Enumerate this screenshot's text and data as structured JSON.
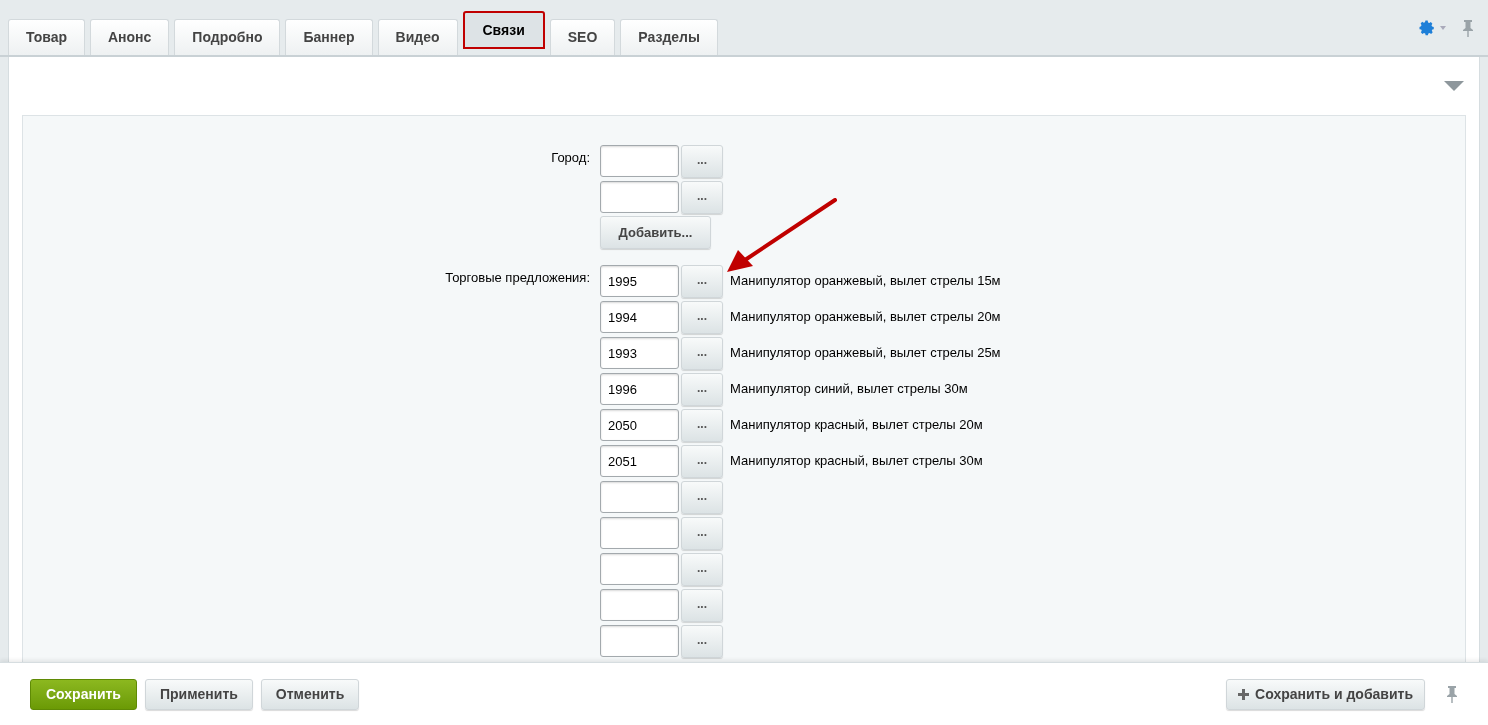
{
  "tabs": [
    {
      "label": "Товар",
      "selected": false
    },
    {
      "label": "Анонс",
      "selected": false
    },
    {
      "label": "Подробно",
      "selected": false
    },
    {
      "label": "Баннер",
      "selected": false
    },
    {
      "label": "Видео",
      "selected": false
    },
    {
      "label": "Связи",
      "selected": true
    },
    {
      "label": "SEO",
      "selected": false
    },
    {
      "label": "Разделы",
      "selected": false
    }
  ],
  "fields": [
    {
      "label": "Город:",
      "browse": "...",
      "rows": [
        {},
        {}
      ],
      "add_button": "Добавить..."
    },
    {
      "label": "Торговые предложения:",
      "browse": "...",
      "rows": [
        {
          "value": "1995",
          "description": "Манипулятор оранжевый, вылет стрелы 15м"
        },
        {
          "value": "1994",
          "description": "Манипулятор оранжевый, вылет стрелы 20м"
        },
        {
          "value": "1993",
          "description": "Манипулятор оранжевый, вылет стрелы 25м"
        },
        {
          "value": "1996",
          "description": "Манипулятор синий, вылет стрелы 30м"
        },
        {
          "value": "2050",
          "description": "Манипулятор красный, вылет стрелы 20м"
        },
        {
          "value": "2051",
          "description": "Манипулятор красный, вылет стрелы 30м"
        },
        {},
        {},
        {},
        {},
        {}
      ]
    }
  ],
  "footer": {
    "buttons": [
      {
        "label": "Сохранить",
        "kind": "primary"
      },
      {
        "label": "Применить",
        "kind": "default"
      },
      {
        "label": "Отменить",
        "kind": "default"
      }
    ],
    "save_and_add": "Сохранить и добавить"
  }
}
